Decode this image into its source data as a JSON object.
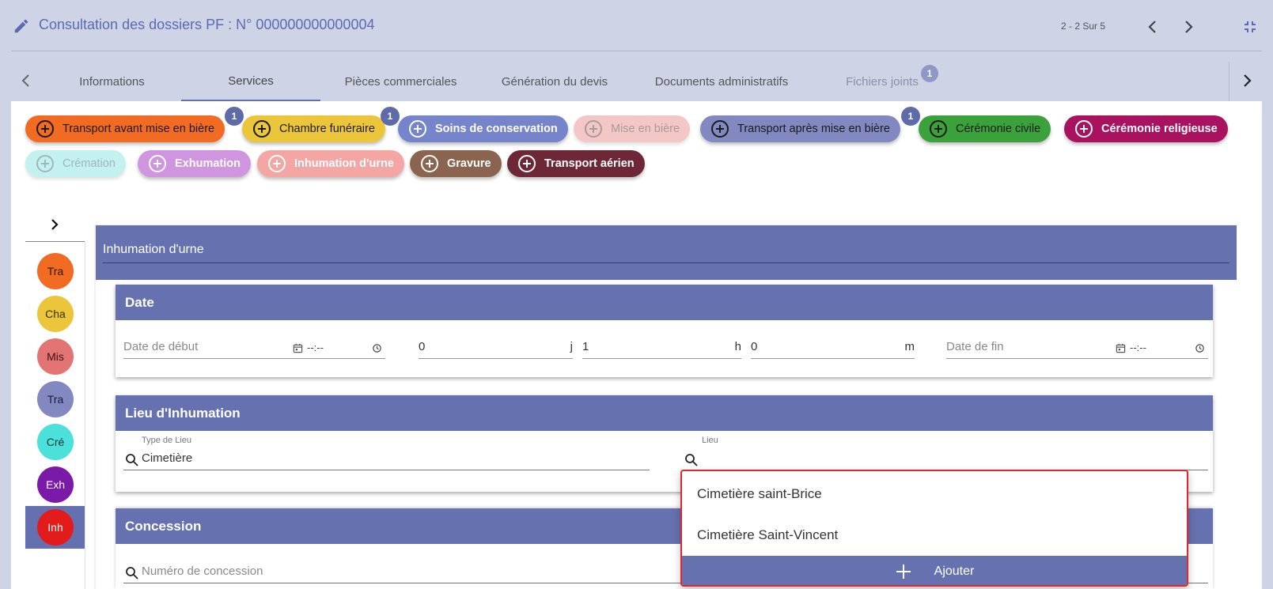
{
  "header": {
    "title": "Consultation des dossiers PF : N° 000000000000004",
    "pager": "2 - 2 Sur 5"
  },
  "tabs": [
    {
      "label": "Informations"
    },
    {
      "label": "Services"
    },
    {
      "label": "Pièces commerciales"
    },
    {
      "label": "Génération du devis"
    },
    {
      "label": "Documents administratifs"
    },
    {
      "label": "Fichiers joints",
      "badge": "1"
    }
  ],
  "service_chips": [
    {
      "label": "Transport avant mise en bière",
      "badge": "1",
      "color": "#f26b22"
    },
    {
      "label": "Chambre funéraire",
      "badge": "1",
      "color": "#ebc63a"
    },
    {
      "label": "Soins de conservation",
      "color": "#7584cb"
    },
    {
      "label": "Mise en bière",
      "color": "#f4c7c7"
    },
    {
      "label": "Transport après mise en bière",
      "badge": "1",
      "color": "#8289c1"
    },
    {
      "label": "Cérémonie civile",
      "color": "#3aa13b"
    },
    {
      "label": "Cérémonie religieuse",
      "color": "#a8125f"
    },
    {
      "label": "Crémation",
      "color": "#c3f1ef"
    },
    {
      "label": "Exhumation",
      "color": "#cf96df"
    },
    {
      "label": "Inhumation d'urne",
      "color": "#f4a6a4"
    },
    {
      "label": "Gravure",
      "color": "#8a644e"
    },
    {
      "label": "Transport aérien",
      "color": "#6e2737"
    }
  ],
  "rail": [
    {
      "label": "Tra",
      "color": "#f26b22"
    },
    {
      "label": "Cha",
      "color": "#ebc63a"
    },
    {
      "label": "Mis",
      "color": "#e27474"
    },
    {
      "label": "Tra",
      "color": "#8289c1"
    },
    {
      "label": "Cré",
      "color": "#4be0da"
    },
    {
      "label": "Exh",
      "color": "#7b19a8"
    },
    {
      "label": "Inh",
      "color": "#e31b1b"
    }
  ],
  "service": {
    "title": "Inhumation d'urne",
    "date_card": {
      "title": "Date",
      "start_placeholder": "Date de début",
      "time_placeholder": "--:--",
      "days_value": "0",
      "days_unit": "j",
      "hours_value": "1",
      "hours_unit": "h",
      "minutes_value": "0",
      "minutes_unit": "m",
      "end_placeholder": "Date de fin",
      "end_time_placeholder": "--:--"
    },
    "lieu_card": {
      "title": "Lieu d'Inhumation",
      "type_label": "Type de Lieu",
      "type_value": "Cimetière",
      "lieu_label": "Lieu"
    },
    "concession_card": {
      "title": "Concession",
      "numero_placeholder": "Numéro de concession"
    }
  },
  "dropdown": {
    "options": [
      "Cimetière saint-Brice",
      "Cimetière Saint-Vincent"
    ],
    "add_label": "Ajouter"
  }
}
